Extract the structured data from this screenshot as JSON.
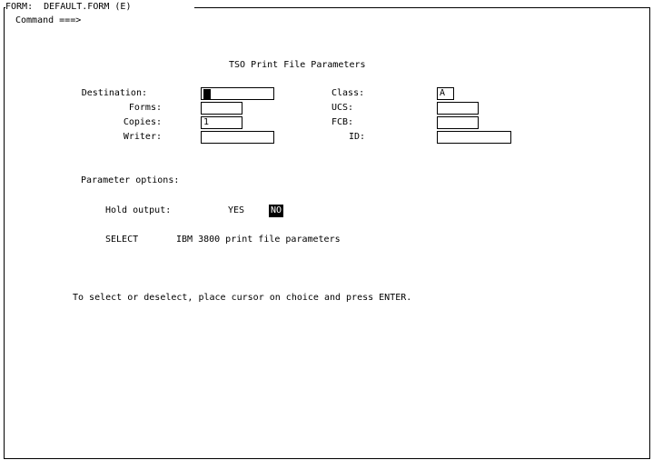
{
  "window": {
    "title": "FORM:  DEFAULT.FORM (E)",
    "command_label": "Command ===>"
  },
  "form": {
    "heading": "TSO Print File Parameters",
    "fields_left": [
      {
        "label": "Destination:",
        "value": ""
      },
      {
        "label": "Forms:",
        "value": ""
      },
      {
        "label": "Copies:",
        "value": "1"
      },
      {
        "label": "Writer:",
        "value": ""
      }
    ],
    "fields_right": [
      {
        "label": "Class:",
        "value": "A"
      },
      {
        "label": "UCS:",
        "value": ""
      },
      {
        "label": "FCB:",
        "value": ""
      },
      {
        "label": "ID:",
        "value": ""
      }
    ],
    "parameter_options_label": "Parameter options:",
    "hold_output": {
      "label": "Hold output:",
      "yes": "YES",
      "no": "NO",
      "selected": "NO"
    },
    "select": {
      "label": "SELECT",
      "description": "IBM 3800 print file parameters"
    },
    "instructions": "To select or deselect, place cursor on choice and press ENTER."
  }
}
